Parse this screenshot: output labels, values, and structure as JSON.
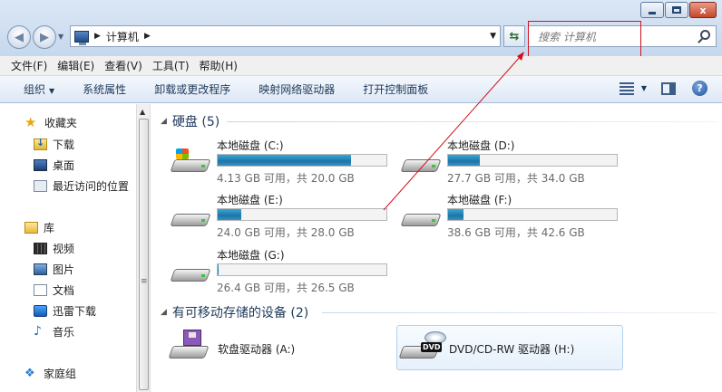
{
  "window": {
    "controls": {
      "minimize": "",
      "maximize": "",
      "close": "x"
    }
  },
  "address_bar": {
    "path": [
      "计算机"
    ],
    "search_placeholder": "搜索 计算机"
  },
  "menu": [
    "文件(F)",
    "编辑(E)",
    "查看(V)",
    "工具(T)",
    "帮助(H)"
  ],
  "toolbar": {
    "organize": "组织",
    "items": [
      "系统属性",
      "卸载或更改程序",
      "映射网络驱动器",
      "打开控制面板"
    ],
    "help": "?"
  },
  "sidebar": {
    "favorites": {
      "label": "收藏夹",
      "items": [
        "下载",
        "桌面",
        "最近访问的位置"
      ]
    },
    "libraries": {
      "label": "库",
      "items": [
        "视频",
        "图片",
        "文档",
        "迅雷下载",
        "音乐"
      ]
    },
    "homegroup": "家庭组"
  },
  "hard_disks": {
    "header": "硬盘 (5)",
    "drives": [
      {
        "name": "本地磁盘 (C:)",
        "info": "4.13 GB 可用，共 20.0 GB",
        "used_fraction": 0.79,
        "system": true
      },
      {
        "name": "本地磁盘 (D:)",
        "info": "27.7 GB 可用，共 34.0 GB",
        "used_fraction": 0.19
      },
      {
        "name": "本地磁盘 (E:)",
        "info": "24.0 GB 可用，共 28.0 GB",
        "used_fraction": 0.14
      },
      {
        "name": "本地磁盘 (F:)",
        "info": "38.6 GB 可用，共 42.6 GB",
        "used_fraction": 0.09
      },
      {
        "name": "本地磁盘 (G:)",
        "info": "26.4 GB 可用，共 26.5 GB",
        "used_fraction": 0.004
      }
    ]
  },
  "removable": {
    "header": "有可移动存储的设备 (2)",
    "devices": [
      {
        "name": "软盘驱动器 (A:)"
      },
      {
        "name": "DVD/CD-RW 驱动器 (H:)",
        "badge": "DVD"
      }
    ]
  },
  "colors": {
    "annotation_red": "#d1121b",
    "usage_bar": "#2a8ec4"
  }
}
